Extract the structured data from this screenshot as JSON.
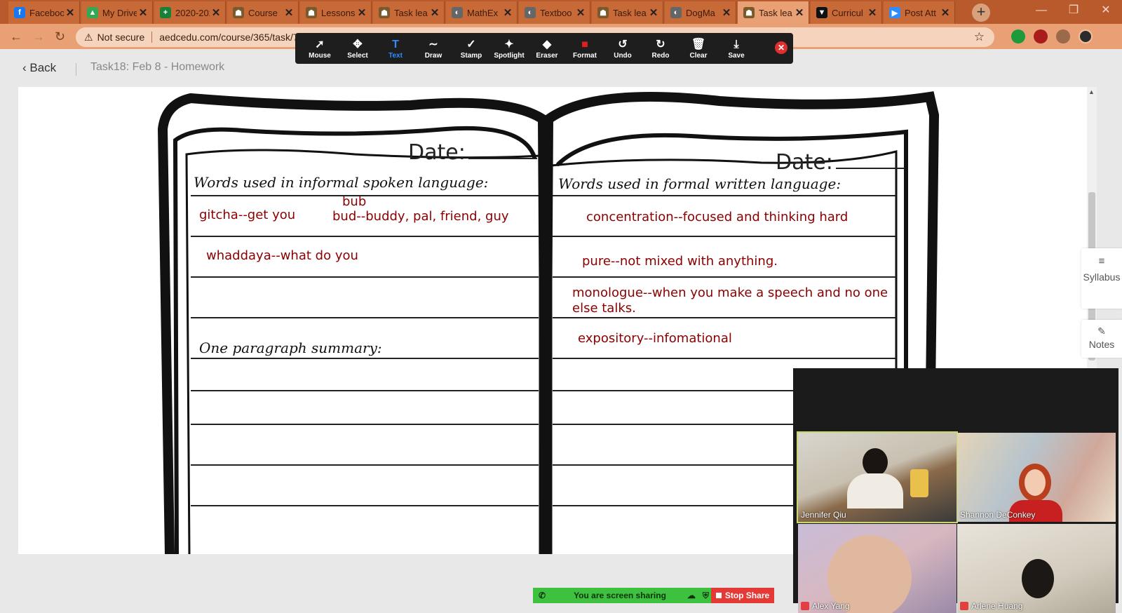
{
  "tabs": [
    {
      "title": "Facebook",
      "favicon": "f",
      "color": "#1877f2"
    },
    {
      "title": "My Drive",
      "favicon": "▲",
      "color": "#34a853"
    },
    {
      "title": "2020-2021",
      "favicon": "+",
      "color": "#188038"
    },
    {
      "title": "Course",
      "favicon": "☗",
      "color": "#7a5a2a"
    },
    {
      "title": "Lessons",
      "favicon": "☗",
      "color": "#7a5a2a"
    },
    {
      "title": "Task lea",
      "favicon": "☗",
      "color": "#7a5a2a"
    },
    {
      "title": "MathEx",
      "favicon": "◐",
      "color": "#666666"
    },
    {
      "title": "Textboo",
      "favicon": "◐",
      "color": "#666666"
    },
    {
      "title": "Task lea",
      "favicon": "☗",
      "color": "#7a5a2a"
    },
    {
      "title": "DogMa",
      "favicon": "◐",
      "color": "#666666"
    },
    {
      "title": "Task lea",
      "favicon": "☗",
      "color": "#7a5a2a",
      "active": true
    },
    {
      "title": "Curricul",
      "favicon": "▼",
      "color": "#111111"
    },
    {
      "title": "Post Att",
      "favicon": "▶",
      "color": "#2d8cff"
    }
  ],
  "address": {
    "security": "Not secure",
    "url": "aedcedu.com/course/365/task/7131..."
  },
  "zoom_toolbar": {
    "tools": [
      {
        "label": "Mouse",
        "icon": "➚"
      },
      {
        "label": "Select",
        "icon": "✥"
      },
      {
        "label": "Text",
        "icon": "T",
        "active": true
      },
      {
        "label": "Draw",
        "icon": "∼"
      },
      {
        "label": "Stamp",
        "icon": "✓"
      },
      {
        "label": "Spotlight",
        "icon": "✦"
      },
      {
        "label": "Eraser",
        "icon": "◆"
      },
      {
        "label": "Format",
        "icon": "■"
      },
      {
        "label": "Undo",
        "icon": "↺"
      },
      {
        "label": "Redo",
        "icon": "↻"
      },
      {
        "label": "Clear",
        "icon": "🗑"
      },
      {
        "label": "Save",
        "icon": "⤓"
      }
    ]
  },
  "page_header": {
    "back_label": "Back",
    "task_title": "Task18:  Feb 8 - Homework"
  },
  "worksheet": {
    "left": {
      "date_label": "Date:",
      "heading": "Words used in informal spoken language:",
      "summary_heading": "One paragraph summary:",
      "entries": {
        "gitcha": "gitcha--get you",
        "bub": "bub",
        "bud": "bud--buddy, pal, friend, guy",
        "whaddaya": "whaddaya--what do you"
      }
    },
    "right": {
      "date_label": "Date:",
      "heading": "Words used in formal written language:",
      "entries": {
        "concentration": "concentration--focused and thinking hard",
        "pure": "pure--not mixed with anything.",
        "monologue": "monologue--when you make  a speech and no one else talks.",
        "expository": "expository--infomational"
      }
    }
  },
  "side_panels": {
    "syllabus_label": "Syllabus",
    "notes_label": "Notes"
  },
  "participants": [
    {
      "name": "Jennifer Qiu",
      "speaking": true
    },
    {
      "name": "Shannon DeConkey"
    },
    {
      "name": "Alex Yang"
    },
    {
      "name": "Arlene Huang"
    }
  ],
  "share_bar": {
    "status": "You are screen sharing",
    "stop_label": "Stop Share"
  }
}
